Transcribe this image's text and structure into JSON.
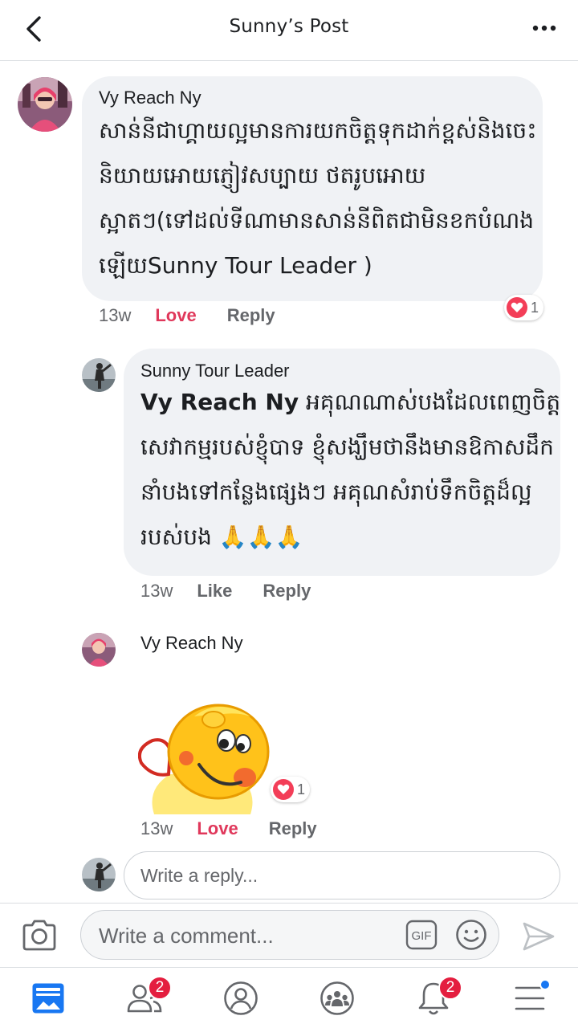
{
  "header": {
    "title": "Sunny’s Post"
  },
  "comments": [
    {
      "author": "Vy Reach Ny",
      "lines": [
        "សាន់នីជាហ្គាយល្អមានការយកចិត្តទុកដាក់ខ្ពស់និងចេះ",
        "និយាយអោយភ្ញៀវសប្បាយ ថតរូបអោយ",
        "ស្អាតៗ(ទៅដល់ទីណាមានសាន់នីពិតជាមិនខកបំណង",
        "ឡើយSunny Tour Leader )"
      ],
      "time": "13w",
      "reaction_label": "Love",
      "reply_label": "Reply",
      "reaction_count": "1"
    },
    {
      "author": "Sunny Tour Leader",
      "mention": "Vy Reach Ny",
      "lines": [
        " អគុណណាស់បងដែលពេញចិត្ត",
        "សេវាកម្មរបស់ខ្ញុំបាទ ខ្ញុំសង្ឃឹមថានឹងមានឱកាសដឹក",
        "នាំបងទៅកន្លែងផ្សេងៗ អគុណសំរាប់ទឹកចិត្តដ៏ល្អ",
        "របស់បង 🙏🙏🙏"
      ],
      "time": "13w",
      "reaction_label": "Like",
      "reply_label": "Reply"
    },
    {
      "author": "Vy Reach Ny",
      "time": "13w",
      "reaction_label": "Love",
      "reply_label": "Reply",
      "reaction_count": "1"
    }
  ],
  "reply_field": {
    "placeholder": "Write a reply..."
  },
  "composer": {
    "placeholder": "Write a comment...",
    "gif_label": "GIF"
  },
  "tabbar": {
    "friends_badge": "2",
    "notifications_badge": "2"
  },
  "colors": {
    "love": "#e0385b",
    "bubble": "#f0f2f5",
    "accent": "#1877f2",
    "badge": "#e41e3f"
  },
  "icons": [
    "back-arrow-icon",
    "more-dots-icon",
    "camera-icon",
    "gif-icon",
    "emoji-icon",
    "send-icon",
    "news-feed-icon",
    "friends-icon",
    "profile-icon",
    "groups-icon",
    "bell-icon",
    "menu-icon",
    "heart-icon"
  ]
}
